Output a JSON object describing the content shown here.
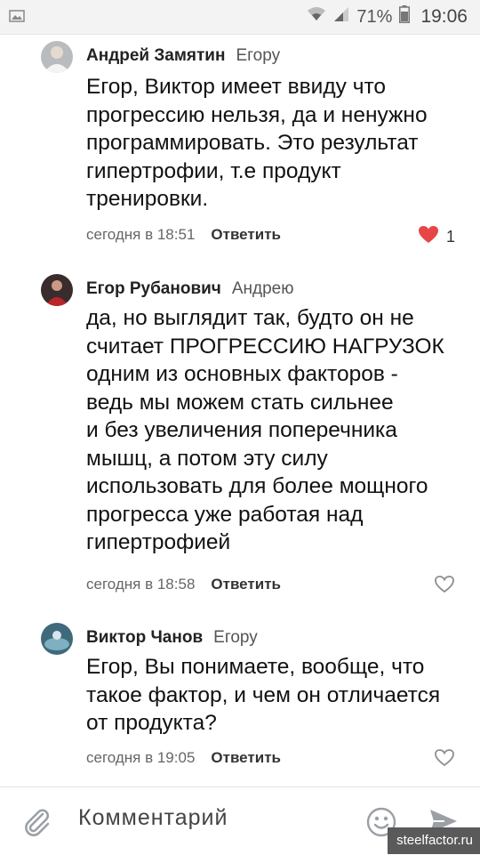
{
  "status_bar": {
    "battery_percent": "71%",
    "time": "19:06"
  },
  "comments": [
    {
      "author": "Андрей Замятин",
      "reply_to": "Егору",
      "lines": [
        "Егор, Виктор имеет ввиду  что",
        "прогрессию нельзя, да и ненужно",
        "программировать. Это результат",
        "гипертрофии, т.е продукт",
        "тренировки."
      ],
      "time": "сегодня в 18:51",
      "reply_label": "Ответить",
      "likes": "1",
      "liked": true
    },
    {
      "author": "Егор Рубанович",
      "reply_to": "Андрею",
      "lines": [
        "да, но выглядит так, будто он не",
        "считает ПРОГРЕССИЮ НАГРУЗОК",
        "одним из основных факторов -",
        "ведь мы можем стать сильнее",
        "и без увеличения поперечника",
        "мышц, а потом эту силу",
        "использовать для более мощного",
        "прогресса уже работая над",
        "гипертрофией"
      ],
      "time": "сегодня в 18:58",
      "reply_label": "Ответить",
      "liked": false
    },
    {
      "author": "Виктор Чанов",
      "reply_to": "Егору",
      "lines": [
        "Егор, Вы понимаете, вообще, что",
        "такое фактор, и чем он отличается",
        "от продукта?"
      ],
      "time": "сегодня в 19:05",
      "reply_label": "Ответить",
      "liked": false
    }
  ],
  "composer": {
    "placeholder": "Комментарий"
  },
  "watermark": "steelfactor.ru",
  "colors": {
    "like_active": "#e64646",
    "like_inactive": "#8e8e8e",
    "icon_gray": "#9aa0a6"
  }
}
